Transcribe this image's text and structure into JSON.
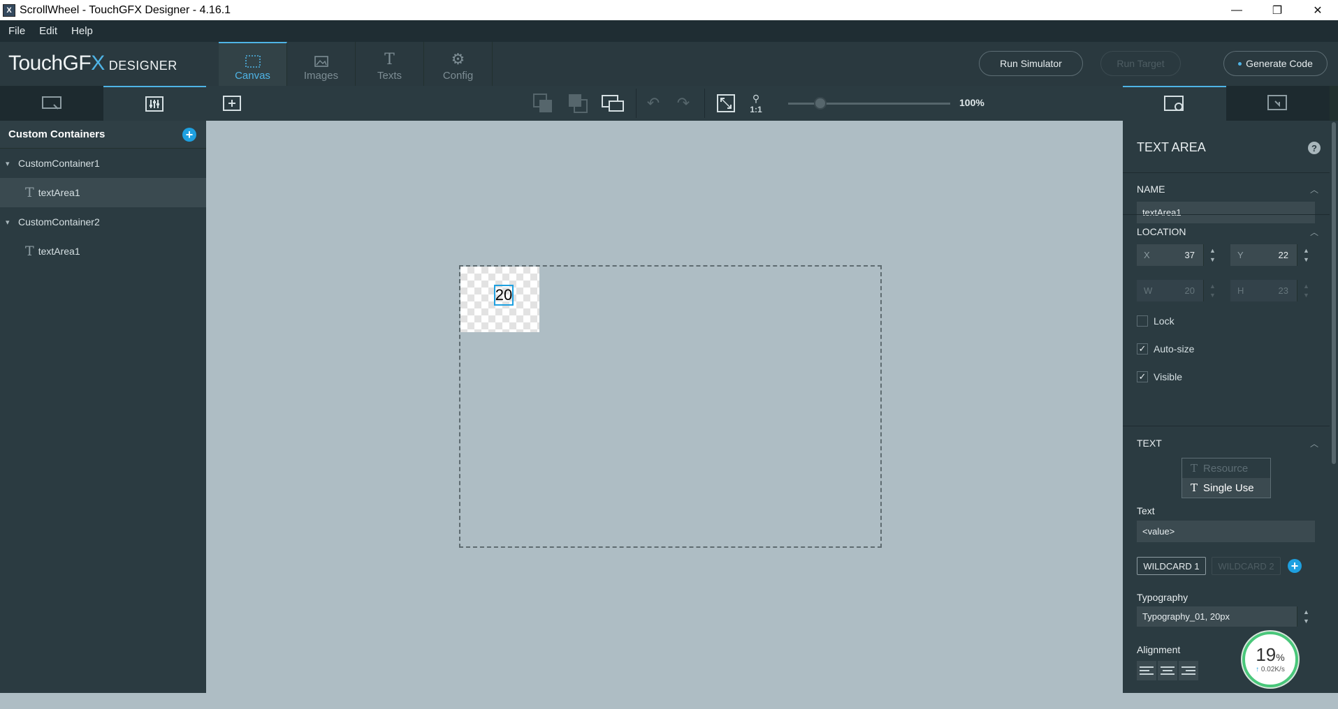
{
  "window": {
    "title": "ScrollWheel - TouchGFX Designer - 4.16.1",
    "app_icon": "X",
    "controls": {
      "minimize": "—",
      "maximize": "❐",
      "close": "✕"
    }
  },
  "menu": [
    "File",
    "Edit",
    "Help"
  ],
  "logo": {
    "touch": "TouchGF",
    "x": "X",
    "designer": "DESIGNER"
  },
  "main_tabs": [
    {
      "label": "Canvas",
      "icon": "canvas-icon"
    },
    {
      "label": "Images",
      "icon": "image-icon"
    },
    {
      "label": "Texts",
      "icon": "text-icon"
    },
    {
      "label": "Config",
      "icon": "gear-icon"
    }
  ],
  "header_buttons": {
    "run_simulator": "Run Simulator",
    "run_target": "Run Target",
    "generate_code": "Generate Code"
  },
  "left_panel": {
    "header": "Custom Containers",
    "tree": [
      {
        "label": "CustomContainer1",
        "children": [
          {
            "label": "textArea1",
            "selected": true
          }
        ]
      },
      {
        "label": "CustomContainer2",
        "children": [
          {
            "label": "textArea1",
            "selected": false
          }
        ]
      }
    ]
  },
  "canvas_toolbar": {
    "zoom": "100%",
    "zoom_level": 0.2,
    "one_to_one": "1:1"
  },
  "canvas": {
    "widget_text": "20"
  },
  "properties": {
    "title": "TEXT AREA",
    "name_section": "NAME",
    "name_value": "textArea1",
    "location_section": "LOCATION",
    "x_label": "X",
    "x_value": "37",
    "y_label": "Y",
    "y_value": "22",
    "w_label": "W",
    "w_value": "20",
    "h_label": "H",
    "h_value": "23",
    "lock": "Lock",
    "autosize": "Auto-size",
    "visible": "Visible",
    "text_section": "TEXT",
    "resource": "Resource",
    "single_use": "Single Use",
    "text_label": "Text",
    "text_value": "<value>",
    "wildcard1": "WILDCARD 1",
    "wildcard2": "WILDCARD 2",
    "typography_label": "Typography",
    "typography_value": "Typography_01, 20px",
    "alignment_label": "Alignment"
  },
  "net_widget": {
    "percent": "19",
    "percent_sign": "%",
    "rate": "0.02K/s",
    "arrow": "↑"
  },
  "colors": {
    "accent": "#4fb4e6",
    "panel": "#2b3b41",
    "canvas": "#aebdc4"
  }
}
